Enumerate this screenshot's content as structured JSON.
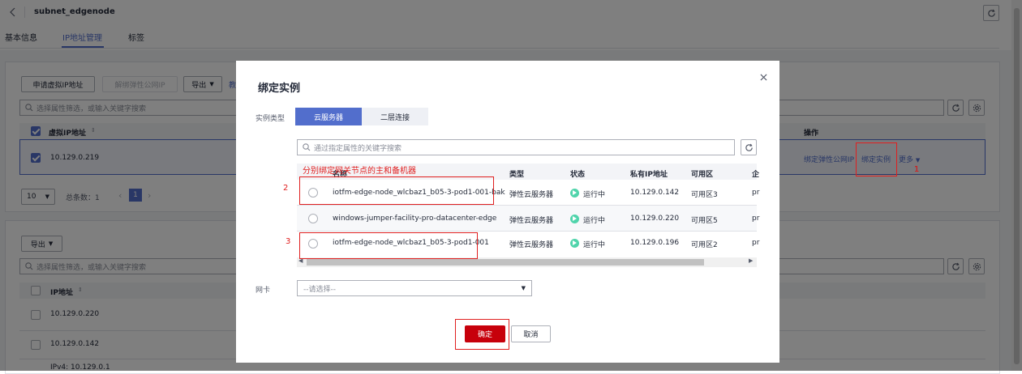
{
  "header": {
    "title": "subnet_edgenode",
    "tabs": [
      {
        "label": "基本信息",
        "active": false
      },
      {
        "label": "IP地址管理",
        "active": true
      },
      {
        "label": "标签",
        "active": false
      }
    ]
  },
  "vip_panel": {
    "apply_vip_button": "申请虚拟IP地址",
    "unbind_eip_button": "解绑弹性公网IP",
    "export_button": "导出",
    "truncated_link": "教",
    "search_placeholder": "选择属性筛选，或输入关键字搜索",
    "col_vip": "虚拟IP地址",
    "col_actions": "操作",
    "row": {
      "vip": "10.129.0.219",
      "action_bind_eip": "绑定弹性公网IP",
      "action_bind_instance": "绑定实例",
      "action_more": "更多"
    },
    "page_size": "10",
    "total_label": "总条数：",
    "total_value": "1",
    "current_page": "1"
  },
  "ip_panel": {
    "export_button": "导出",
    "search_placeholder": "选择属性筛选，或输入关键字搜索",
    "col_ip": "IP地址",
    "rows": [
      "10.129.0.220",
      "10.129.0.142",
      "IPv4: 10.129.0.1"
    ]
  },
  "modal": {
    "title": "绑定实例",
    "instance_type_label": "实例类型",
    "type_tabs": [
      {
        "label": "云服务器",
        "active": true
      },
      {
        "label": "二层连接",
        "active": false
      }
    ],
    "search_placeholder": "通过指定属性的关键字搜索",
    "columns": {
      "name": "名称",
      "type": "类型",
      "status": "状态",
      "private_ip": "私有IP地址",
      "az": "可用区",
      "extra": "企"
    },
    "rows": [
      {
        "name": "iotfm-edge-node_wlcbaz1_b05-3-pod1-001-bak",
        "type": "弹性云服务器",
        "status": "运行中",
        "ip": "10.129.0.142",
        "az": "可用区3",
        "extra": "pr"
      },
      {
        "name": "windows-jumper-facility-pro-datacenter-edge",
        "type": "弹性云服务器",
        "status": "运行中",
        "ip": "10.129.0.220",
        "az": "可用区5",
        "extra": "pr"
      },
      {
        "name": "iotfm-edge-node_wlcbaz1_b05-3-pod1-001",
        "type": "弹性云服务器",
        "status": "运行中",
        "ip": "10.129.0.196",
        "az": "可用区2",
        "extra": "pr"
      }
    ],
    "nic_label": "网卡",
    "nic_placeholder": "--请选择--",
    "confirm_button": "确定",
    "cancel_button": "取消"
  },
  "annotations": {
    "note": "分别绑定网关节点的主和备机器",
    "marker_1": "1",
    "marker_2": "2",
    "marker_3": "3",
    "color": "#e02020"
  },
  "colors": {
    "accent": "#526ecc",
    "status_running": "#50d4ab",
    "confirm": "#c7000b"
  }
}
